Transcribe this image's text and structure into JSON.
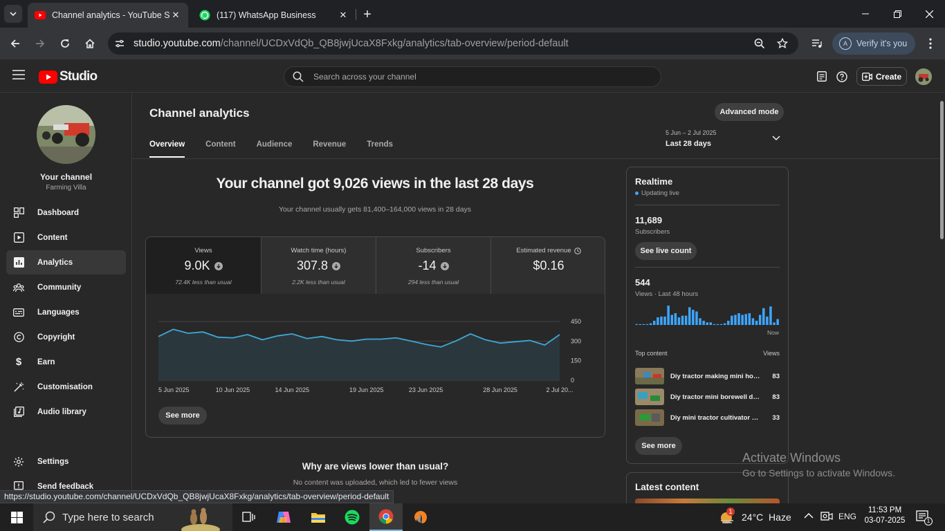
{
  "browser": {
    "tabs": [
      {
        "title": "Channel analytics - YouTube Stu",
        "active": true,
        "icon": "youtube-icon"
      },
      {
        "title": "(117) WhatsApp Business",
        "active": false,
        "icon": "whatsapp-icon"
      }
    ],
    "url_host": "studio.youtube.com",
    "url_path": "/channel/UCDxVdQb_QB8jwjUcaX8Fxkg/analytics/tab-overview/period-default",
    "verify_label": "Verify it's you",
    "verify_avatar": "A",
    "status_url": "https://studio.youtube.com/channel/UCDxVdQb_QB8jwjUcaX8Fxkg/analytics/tab-overview/period-default"
  },
  "studio": {
    "logo_text": "Studio",
    "search_placeholder": "Search across your channel",
    "create_label": "Create"
  },
  "sidebar": {
    "channel_title": "Your channel",
    "channel_name": "Farming Villa",
    "items": [
      {
        "label": "Dashboard",
        "icon": "dashboard-icon",
        "active": false
      },
      {
        "label": "Content",
        "icon": "content-icon",
        "active": false
      },
      {
        "label": "Analytics",
        "icon": "analytics-icon",
        "active": true
      },
      {
        "label": "Community",
        "icon": "community-icon",
        "active": false
      },
      {
        "label": "Languages",
        "icon": "languages-icon",
        "active": false
      },
      {
        "label": "Copyright",
        "icon": "copyright-icon",
        "active": false
      },
      {
        "label": "Earn",
        "icon": "earn-icon",
        "active": false
      },
      {
        "label": "Customisation",
        "icon": "customisation-icon",
        "active": false
      },
      {
        "label": "Audio library",
        "icon": "audio-library-icon",
        "active": false
      }
    ],
    "settings_label": "Settings",
    "feedback_label": "Send feedback"
  },
  "analytics": {
    "title": "Channel analytics",
    "advanced_label": "Advanced mode",
    "tabs": [
      "Overview",
      "Content",
      "Audience",
      "Revenue",
      "Trends"
    ],
    "date_range": "5 Jun – 2 Jul 2025",
    "date_label": "Last 28 days",
    "headline": "Your channel got 9,026 views in the last 28 days",
    "subline": "Your channel usually gets 81,400–164,000 views in 28 days",
    "metrics": [
      {
        "label": "Views",
        "value": "9.0K",
        "note": "72.4K less than usual",
        "trend": "down"
      },
      {
        "label": "Watch time (hours)",
        "value": "307.8",
        "note": "2.2K less than usual",
        "trend": "down"
      },
      {
        "label": "Subscribers",
        "value": "-14",
        "note": "294 less than usual",
        "trend": "down"
      },
      {
        "label": "Estimated revenue",
        "value": "$0.16",
        "note": "",
        "trend": "none"
      }
    ],
    "see_more_label": "See more",
    "why_title": "Why are views lower than usual?",
    "why_text": "No content was uploaded, which led to fewer views"
  },
  "chart_data": {
    "type": "area",
    "x": [
      "5 Jun 2025",
      "6 Jun",
      "7 Jun",
      "8 Jun",
      "9 Jun",
      "10 Jun 2025",
      "11 Jun",
      "12 Jun",
      "13 Jun",
      "14 Jun 2025",
      "15 Jun",
      "16 Jun",
      "17 Jun",
      "18 Jun",
      "19 Jun 2025",
      "20 Jun",
      "21 Jun",
      "22 Jun",
      "23 Jun 2025",
      "24 Jun",
      "25 Jun",
      "26 Jun",
      "27 Jun",
      "28 Jun 2025",
      "29 Jun",
      "30 Jun",
      "1 Jul",
      "2 Jul 2025"
    ],
    "values": [
      335,
      390,
      360,
      370,
      330,
      325,
      350,
      310,
      340,
      355,
      320,
      335,
      310,
      300,
      315,
      315,
      325,
      300,
      275,
      255,
      300,
      355,
      310,
      285,
      295,
      305,
      270,
      350
    ],
    "x_tick_labels": [
      "5 Jun 2025",
      "10 Jun 2025",
      "14 Jun 2025",
      "19 Jun 2025",
      "23 Jun 2025",
      "28 Jun 2025",
      "2 Jul 20..."
    ],
    "x_tick_index": [
      0,
      5,
      9,
      14,
      18,
      23,
      27
    ],
    "y_ticks": [
      0,
      150,
      300,
      450
    ],
    "ylim": [
      0,
      450
    ],
    "grid": true,
    "line_color": "#41a8d6",
    "fill_color": "#2a3a40"
  },
  "realtime": {
    "title": "Realtime",
    "live_label": "Updating live",
    "subscribers": "11,689",
    "subscribers_label": "Subscribers",
    "live_count_label": "See live count",
    "views": "544",
    "views_label": "Views · Last 48 hours",
    "hourly_views": [
      1,
      1,
      1,
      1,
      2,
      5,
      9,
      10,
      10,
      23,
      12,
      14,
      9,
      11,
      11,
      21,
      18,
      16,
      8,
      5,
      3,
      3,
      1,
      1,
      1,
      2,
      5,
      11,
      12,
      14,
      12,
      13,
      14,
      8,
      5,
      12,
      20,
      10,
      22,
      3,
      7
    ],
    "now_label": "Now",
    "bar_color": "#3ea6ff",
    "top_content_label": "Top content",
    "top_views_label": "Views",
    "top_content": [
      {
        "title": "Diy tractor making mini hou...",
        "views": "83"
      },
      {
        "title": "Diy tractor mini borewell drill...",
        "views": "83"
      },
      {
        "title": "Diy mini tractor cultivator pl...",
        "views": "33"
      }
    ],
    "see_more_label": "See more",
    "latest_title": "Latest content"
  },
  "watermark": {
    "line1": "Activate Windows",
    "line2": "Go to Settings to activate Windows."
  },
  "taskbar": {
    "search_placeholder": "Type here to search",
    "weather_badge": "1",
    "weather": "24°C  Haze",
    "language": "ENG",
    "time": "11:53 PM",
    "date": "03-07-2025",
    "notification_count": "1"
  }
}
